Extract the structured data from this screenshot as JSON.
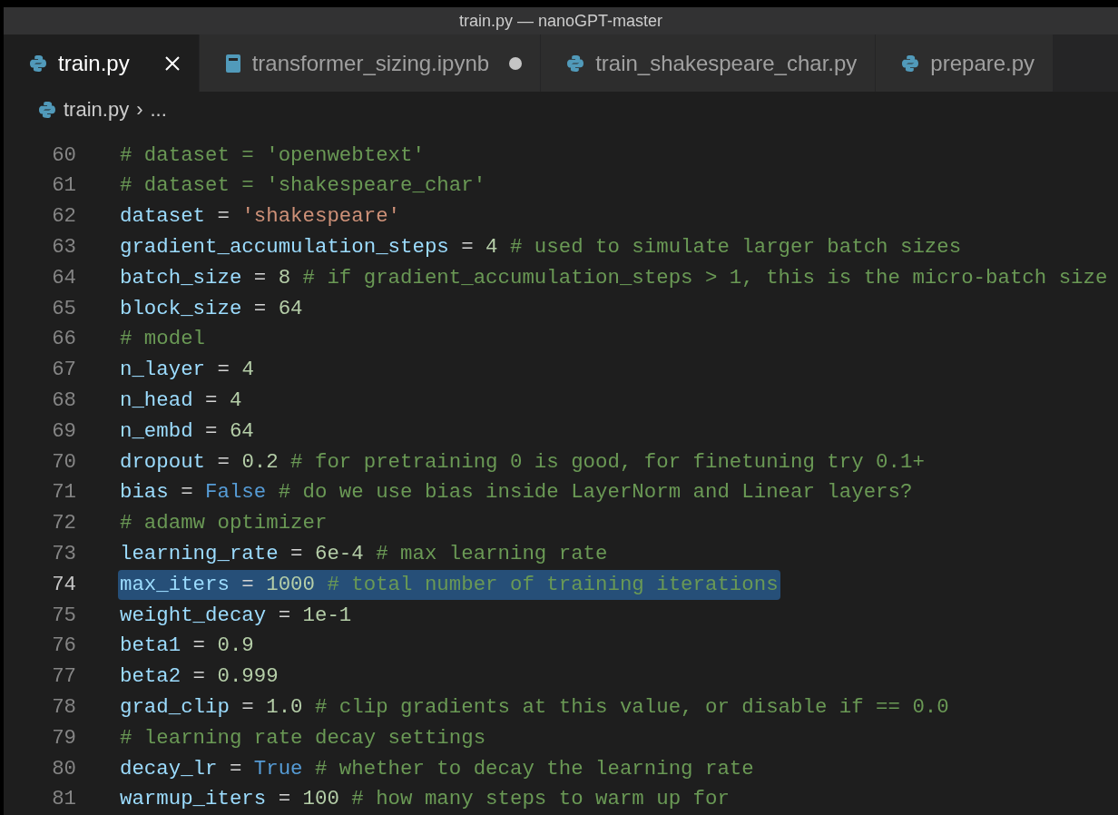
{
  "window": {
    "title": "train.py — nanoGPT-master"
  },
  "tabs": [
    {
      "label": "train.py",
      "kind": "python",
      "selected": true,
      "dirty": false
    },
    {
      "label": "transformer_sizing.ipynb",
      "kind": "notebook",
      "selected": false,
      "dirty": true
    },
    {
      "label": "train_shakespeare_char.py",
      "kind": "python",
      "selected": false,
      "dirty": false
    },
    {
      "label": "prepare.py",
      "kind": "python",
      "selected": false,
      "dirty": false
    }
  ],
  "breadcrumb": {
    "file": "train.py",
    "separator": "›",
    "rest": "..."
  },
  "lines": [
    {
      "number": "60",
      "selected": false,
      "tokens": [
        {
          "kind": "comment",
          "text": "# dataset = 'openwebtext'"
        }
      ]
    },
    {
      "number": "61",
      "selected": false,
      "tokens": [
        {
          "kind": "comment",
          "text": "# dataset = 'shakespeare_char'"
        }
      ]
    },
    {
      "number": "62",
      "selected": false,
      "tokens": [
        {
          "kind": "var",
          "text": "dataset"
        },
        {
          "kind": "op",
          "text": " = "
        },
        {
          "kind": "str",
          "text": "'shakespeare'"
        }
      ]
    },
    {
      "number": "63",
      "selected": false,
      "tokens": [
        {
          "kind": "var",
          "text": "gradient_accumulation_steps"
        },
        {
          "kind": "op",
          "text": " = "
        },
        {
          "kind": "num",
          "text": "4"
        },
        {
          "kind": "comment",
          "text": " # used to simulate larger batch sizes"
        }
      ]
    },
    {
      "number": "64",
      "selected": false,
      "tokens": [
        {
          "kind": "var",
          "text": "batch_size"
        },
        {
          "kind": "op",
          "text": " = "
        },
        {
          "kind": "num",
          "text": "8"
        },
        {
          "kind": "comment",
          "text": " # if gradient_accumulation_steps > 1, this is the micro-batch size"
        }
      ]
    },
    {
      "number": "65",
      "selected": false,
      "tokens": [
        {
          "kind": "var",
          "text": "block_size"
        },
        {
          "kind": "op",
          "text": " = "
        },
        {
          "kind": "num",
          "text": "64"
        }
      ]
    },
    {
      "number": "66",
      "selected": false,
      "tokens": [
        {
          "kind": "comment",
          "text": "# model"
        }
      ]
    },
    {
      "number": "67",
      "selected": false,
      "tokens": [
        {
          "kind": "var",
          "text": "n_layer"
        },
        {
          "kind": "op",
          "text": " = "
        },
        {
          "kind": "num",
          "text": "4"
        }
      ]
    },
    {
      "number": "68",
      "selected": false,
      "tokens": [
        {
          "kind": "var",
          "text": "n_head"
        },
        {
          "kind": "op",
          "text": " = "
        },
        {
          "kind": "num",
          "text": "4"
        }
      ]
    },
    {
      "number": "69",
      "selected": false,
      "tokens": [
        {
          "kind": "var",
          "text": "n_embd"
        },
        {
          "kind": "op",
          "text": " = "
        },
        {
          "kind": "num",
          "text": "64"
        }
      ]
    },
    {
      "number": "70",
      "selected": false,
      "tokens": [
        {
          "kind": "var",
          "text": "dropout"
        },
        {
          "kind": "op",
          "text": " = "
        },
        {
          "kind": "num",
          "text": "0.2"
        },
        {
          "kind": "comment",
          "text": " # for pretraining 0 is good, for finetuning try 0.1+"
        }
      ]
    },
    {
      "number": "71",
      "selected": false,
      "tokens": [
        {
          "kind": "var",
          "text": "bias"
        },
        {
          "kind": "op",
          "text": " = "
        },
        {
          "kind": "kw",
          "text": "False"
        },
        {
          "kind": "comment",
          "text": " # do we use bias inside LayerNorm and Linear layers?"
        }
      ]
    },
    {
      "number": "72",
      "selected": false,
      "tokens": [
        {
          "kind": "comment",
          "text": "# adamw optimizer"
        }
      ]
    },
    {
      "number": "73",
      "selected": false,
      "tokens": [
        {
          "kind": "var",
          "text": "learning_rate"
        },
        {
          "kind": "op",
          "text": " = "
        },
        {
          "kind": "num",
          "text": "6e-4"
        },
        {
          "kind": "comment",
          "text": " # max learning rate"
        }
      ]
    },
    {
      "number": "74",
      "selected": true,
      "tokens": [
        {
          "kind": "var",
          "text": "max_iters"
        },
        {
          "kind": "op",
          "text": " = "
        },
        {
          "kind": "num",
          "text": "1000"
        },
        {
          "kind": "comment",
          "text": " # total number of training iterations"
        }
      ]
    },
    {
      "number": "75",
      "selected": false,
      "tokens": [
        {
          "kind": "var",
          "text": "weight_decay"
        },
        {
          "kind": "op",
          "text": " = "
        },
        {
          "kind": "num",
          "text": "1e-1"
        }
      ]
    },
    {
      "number": "76",
      "selected": false,
      "tokens": [
        {
          "kind": "var",
          "text": "beta1"
        },
        {
          "kind": "op",
          "text": " = "
        },
        {
          "kind": "num",
          "text": "0.9"
        }
      ]
    },
    {
      "number": "77",
      "selected": false,
      "tokens": [
        {
          "kind": "var",
          "text": "beta2"
        },
        {
          "kind": "op",
          "text": " = "
        },
        {
          "kind": "num",
          "text": "0.999"
        }
      ]
    },
    {
      "number": "78",
      "selected": false,
      "tokens": [
        {
          "kind": "var",
          "text": "grad_clip"
        },
        {
          "kind": "op",
          "text": " = "
        },
        {
          "kind": "num",
          "text": "1.0"
        },
        {
          "kind": "comment",
          "text": " # clip gradients at this value, or disable if == 0.0"
        }
      ]
    },
    {
      "number": "79",
      "selected": false,
      "tokens": [
        {
          "kind": "comment",
          "text": "# learning rate decay settings"
        }
      ]
    },
    {
      "number": "80",
      "selected": false,
      "tokens": [
        {
          "kind": "var",
          "text": "decay_lr"
        },
        {
          "kind": "op",
          "text": " = "
        },
        {
          "kind": "kw",
          "text": "True"
        },
        {
          "kind": "comment",
          "text": " # whether to decay the learning rate"
        }
      ]
    },
    {
      "number": "81",
      "selected": false,
      "tokens": [
        {
          "kind": "var",
          "text": "warmup_iters"
        },
        {
          "kind": "op",
          "text": " = "
        },
        {
          "kind": "num",
          "text": "100"
        },
        {
          "kind": "comment",
          "text": " # how many steps to warm up for"
        }
      ]
    }
  ]
}
